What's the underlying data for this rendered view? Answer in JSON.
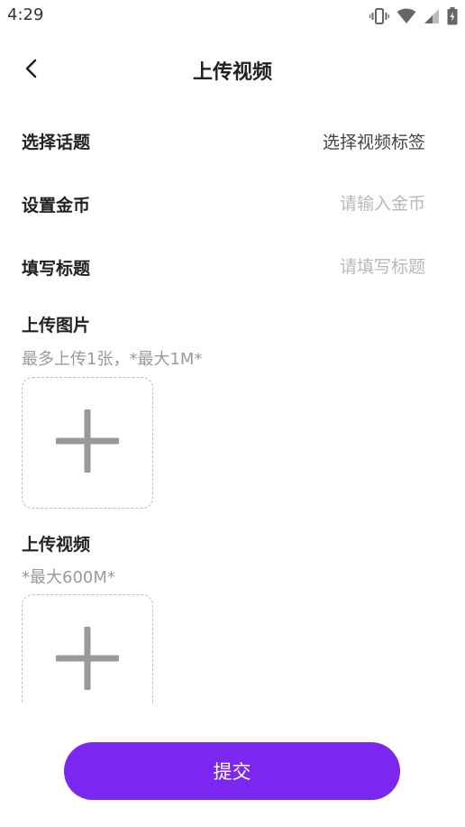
{
  "status_bar": {
    "time": "4:29",
    "icons": [
      "vibrate-icon",
      "wifi-icon",
      "signal-icon",
      "battery-icon"
    ]
  },
  "nav": {
    "title": "上传视频",
    "back_icon": "chevron-left-icon"
  },
  "form": {
    "topic": {
      "label": "选择话题",
      "value": "选择视频标签"
    },
    "coins": {
      "label": "设置金币",
      "placeholder": "请输入金币",
      "value": ""
    },
    "title": {
      "label": "填写标题",
      "placeholder": "请填写标题",
      "value": ""
    }
  },
  "upload_image": {
    "title": "上传图片",
    "hint": "最多上传1张，*最大1M*",
    "icon": "plus-icon"
  },
  "upload_video": {
    "title": "上传视频",
    "hint": "*最大600M*",
    "icon": "plus-icon"
  },
  "submit": {
    "label": "提交"
  },
  "colors": {
    "accent": "#7b27f0",
    "placeholder": "#b8b8b8",
    "hint": "#9a9a9a",
    "plus": "#999999"
  }
}
